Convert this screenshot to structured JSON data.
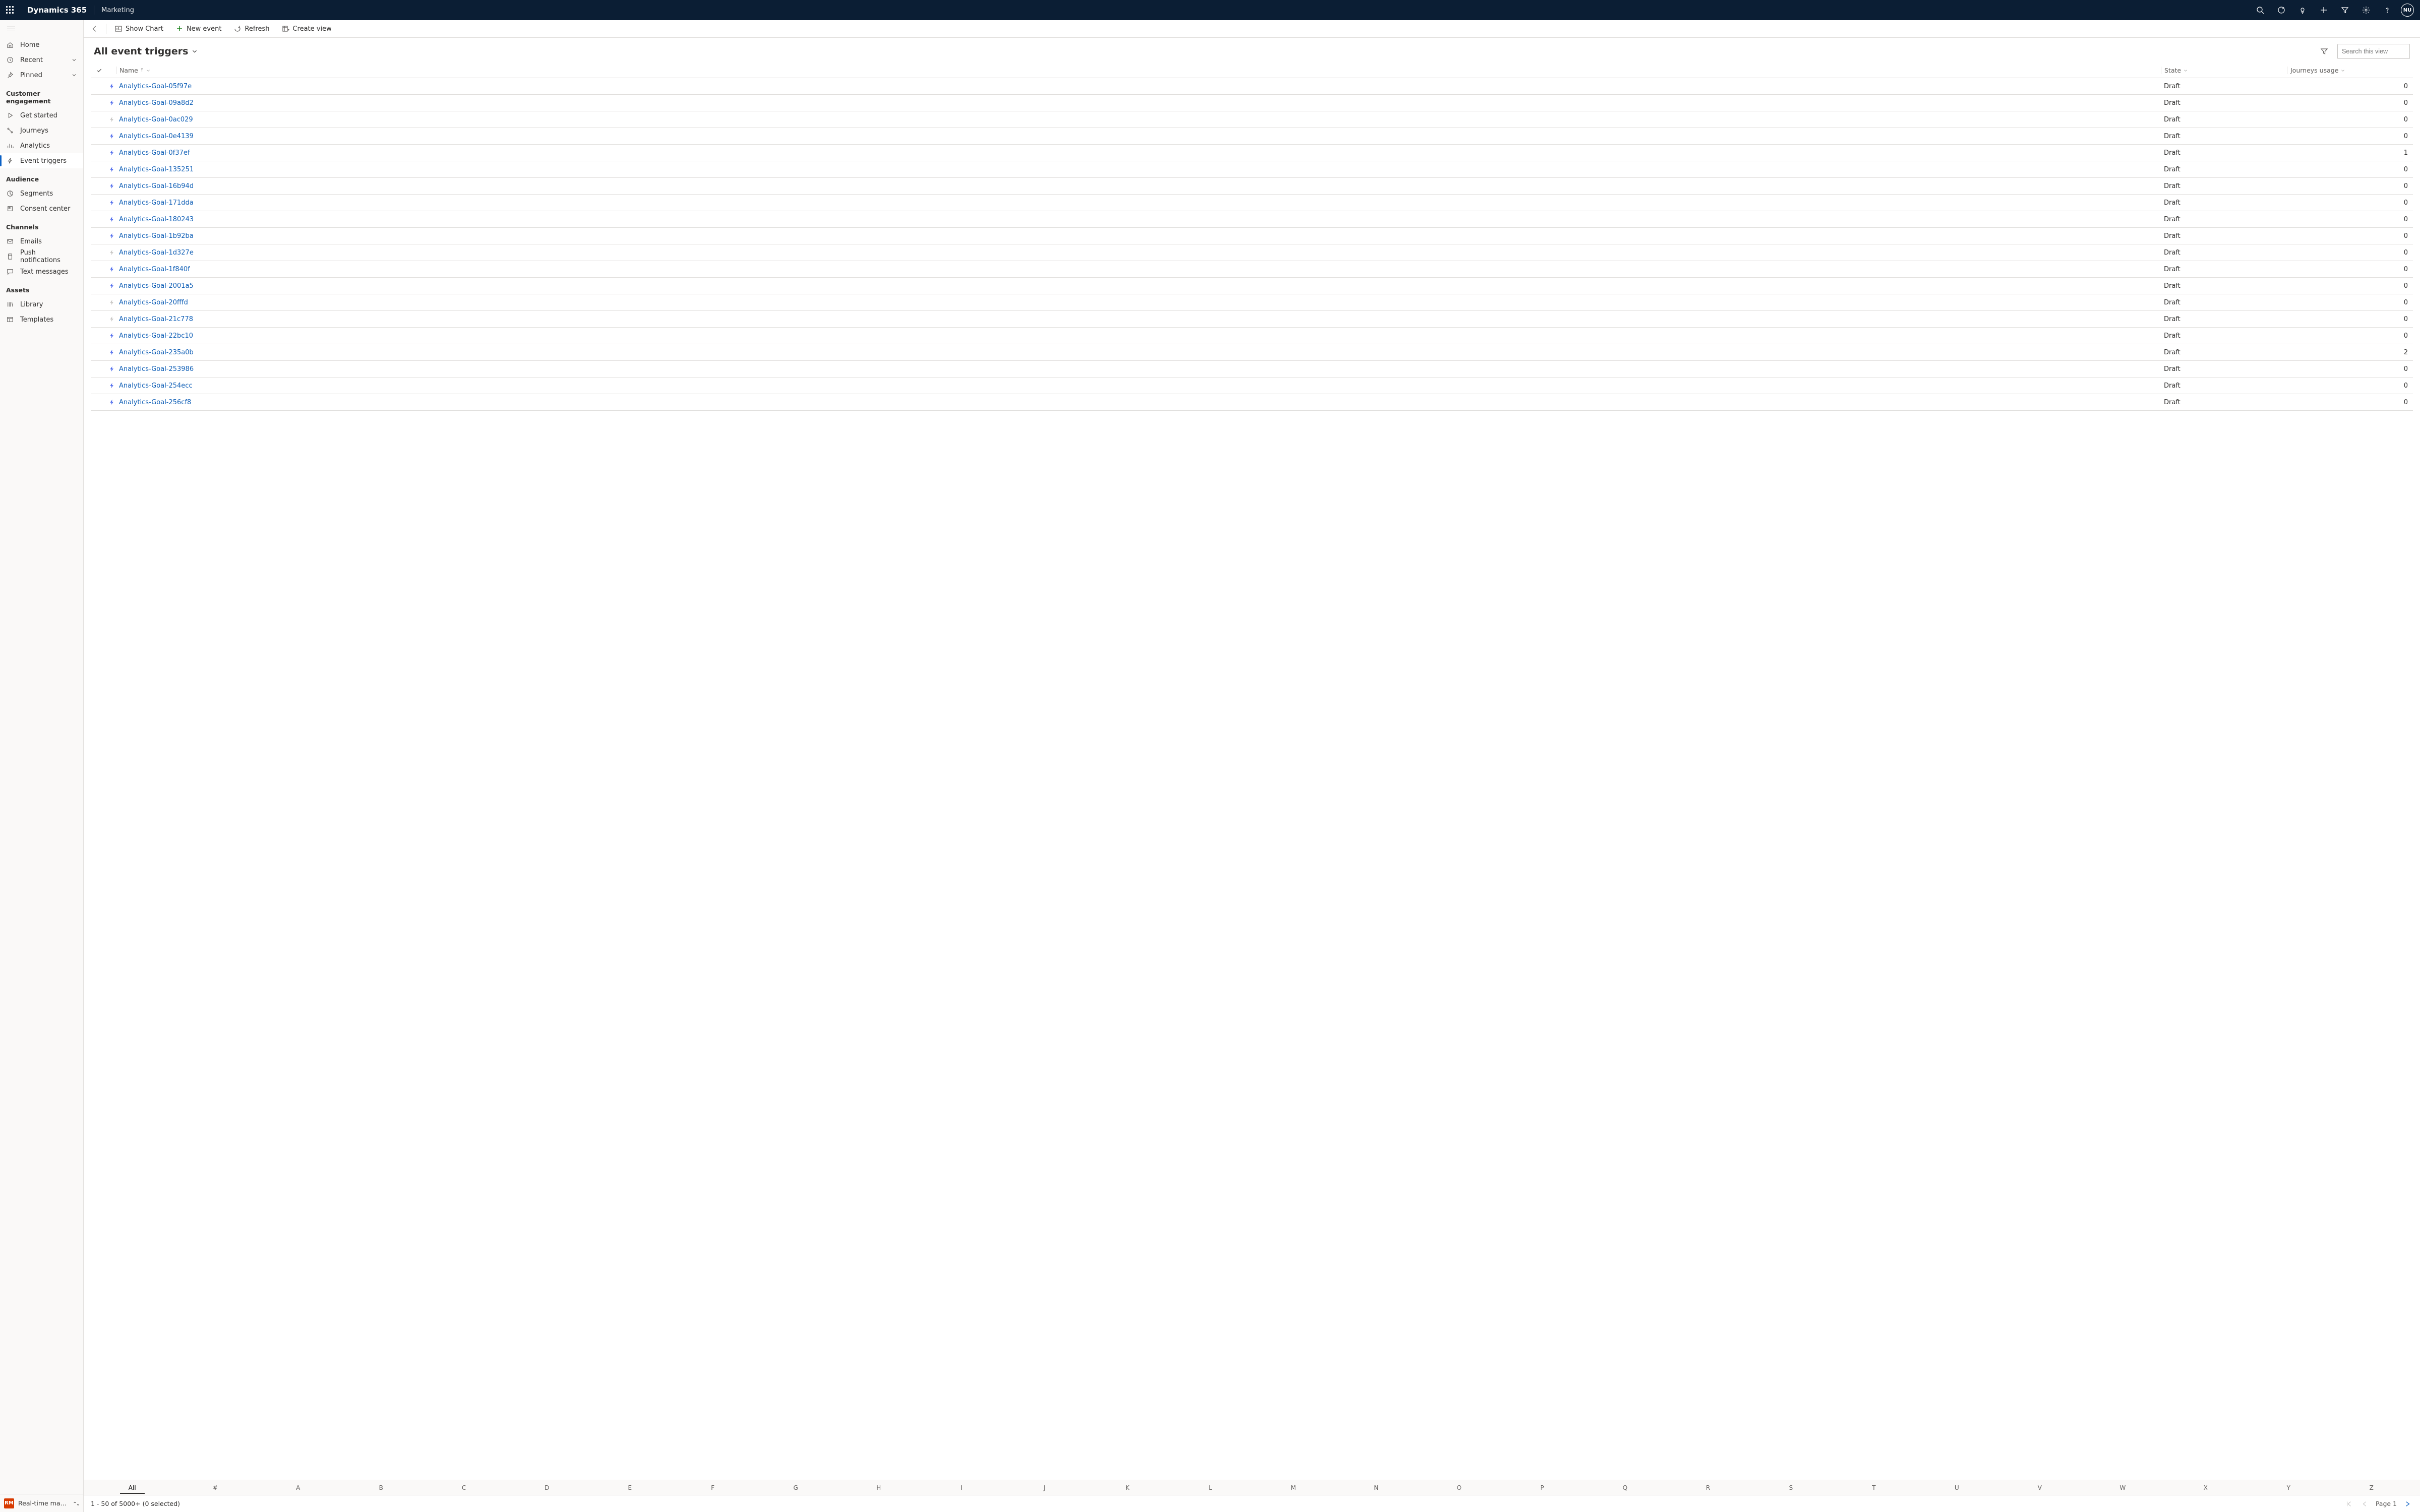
{
  "header": {
    "brand": "Dynamics 365",
    "area": "Marketing",
    "avatar_initials": "NU"
  },
  "nav": {
    "top": [
      {
        "label": "Home",
        "icon": "home"
      },
      {
        "label": "Recent",
        "icon": "clock",
        "chevron": true
      },
      {
        "label": "Pinned",
        "icon": "pin",
        "chevron": true
      }
    ],
    "sections": [
      {
        "title": "Customer engagement",
        "items": [
          {
            "label": "Get started",
            "icon": "play"
          },
          {
            "label": "Journeys",
            "icon": "journey"
          },
          {
            "label": "Analytics",
            "icon": "bars"
          },
          {
            "label": "Event triggers",
            "icon": "bolt",
            "selected": true
          }
        ]
      },
      {
        "title": "Audience",
        "items": [
          {
            "label": "Segments",
            "icon": "segments"
          },
          {
            "label": "Consent center",
            "icon": "consent"
          }
        ]
      },
      {
        "title": "Channels",
        "items": [
          {
            "label": "Emails",
            "icon": "mail"
          },
          {
            "label": "Push notifications",
            "icon": "push"
          },
          {
            "label": "Text messages",
            "icon": "chat"
          }
        ]
      },
      {
        "title": "Assets",
        "items": [
          {
            "label": "Library",
            "icon": "library"
          },
          {
            "label": "Templates",
            "icon": "template"
          }
        ]
      }
    ],
    "area_switcher": {
      "badge": "RM",
      "label": "Real-time marketi..."
    }
  },
  "commandbar": {
    "show_chart": "Show Chart",
    "new_event": "New event",
    "refresh": "Refresh",
    "create_view": "Create view"
  },
  "view": {
    "title": "All event triggers",
    "search_placeholder": "Search this view"
  },
  "columns": {
    "name": "Name",
    "state": "State",
    "journeys": "Journeys usage"
  },
  "rows": [
    {
      "name": "Analytics-Goal-05f97e",
      "state": "Draft",
      "usage": 0,
      "active": true
    },
    {
      "name": "Analytics-Goal-09a8d2",
      "state": "Draft",
      "usage": 0,
      "active": true
    },
    {
      "name": "Analytics-Goal-0ac029",
      "state": "Draft",
      "usage": 0,
      "active": false
    },
    {
      "name": "Analytics-Goal-0e4139",
      "state": "Draft",
      "usage": 0,
      "active": true
    },
    {
      "name": "Analytics-Goal-0f37ef",
      "state": "Draft",
      "usage": 1,
      "active": true
    },
    {
      "name": "Analytics-Goal-135251",
      "state": "Draft",
      "usage": 0,
      "active": true
    },
    {
      "name": "Analytics-Goal-16b94d",
      "state": "Draft",
      "usage": 0,
      "active": true
    },
    {
      "name": "Analytics-Goal-171dda",
      "state": "Draft",
      "usage": 0,
      "active": true
    },
    {
      "name": "Analytics-Goal-180243",
      "state": "Draft",
      "usage": 0,
      "active": true
    },
    {
      "name": "Analytics-Goal-1b92ba",
      "state": "Draft",
      "usage": 0,
      "active": true
    },
    {
      "name": "Analytics-Goal-1d327e",
      "state": "Draft",
      "usage": 0,
      "active": false
    },
    {
      "name": "Analytics-Goal-1f840f",
      "state": "Draft",
      "usage": 0,
      "active": true
    },
    {
      "name": "Analytics-Goal-2001a5",
      "state": "Draft",
      "usage": 0,
      "active": true
    },
    {
      "name": "Analytics-Goal-20fffd",
      "state": "Draft",
      "usage": 0,
      "active": false
    },
    {
      "name": "Analytics-Goal-21c778",
      "state": "Draft",
      "usage": 0,
      "active": false
    },
    {
      "name": "Analytics-Goal-22bc10",
      "state": "Draft",
      "usage": 0,
      "active": true
    },
    {
      "name": "Analytics-Goal-235a0b",
      "state": "Draft",
      "usage": 2,
      "active": true
    },
    {
      "name": "Analytics-Goal-253986",
      "state": "Draft",
      "usage": 0,
      "active": true
    },
    {
      "name": "Analytics-Goal-254ecc",
      "state": "Draft",
      "usage": 0,
      "active": true
    },
    {
      "name": "Analytics-Goal-256cf8",
      "state": "Draft",
      "usage": 0,
      "active": true
    }
  ],
  "alphabar": [
    "All",
    "#",
    "A",
    "B",
    "C",
    "D",
    "E",
    "F",
    "G",
    "H",
    "I",
    "J",
    "K",
    "L",
    "M",
    "N",
    "O",
    "P",
    "Q",
    "R",
    "S",
    "T",
    "U",
    "V",
    "W",
    "X",
    "Y",
    "Z"
  ],
  "statusbar": {
    "summary": "1 - 50 of 5000+  (0 selected)",
    "page_label": "Page 1"
  }
}
